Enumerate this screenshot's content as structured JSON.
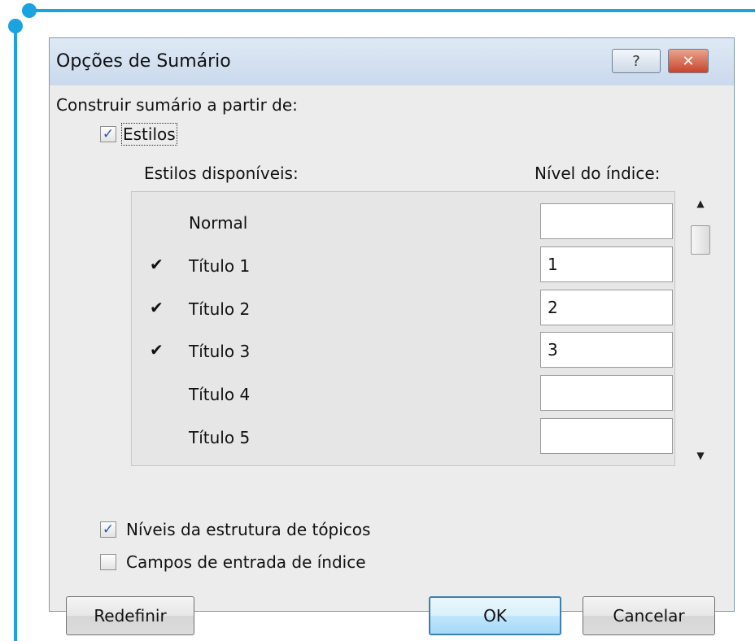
{
  "dialog": {
    "title": "Opções de Sumário",
    "help_glyph": "?",
    "close_glyph": "✕"
  },
  "build_from_label": "Construir sumário a partir de:",
  "styles_checkbox": {
    "label": "Estilos",
    "checked": true
  },
  "available_styles_header": "Estilos disponíveis:",
  "index_level_header": "Nível do índice:",
  "styles": [
    {
      "checked": true,
      "mark": "",
      "name": "Normal",
      "level": ""
    },
    {
      "checked": true,
      "mark": "✔",
      "name": "Título 1",
      "level": "1"
    },
    {
      "checked": true,
      "mark": "✔",
      "name": "Título 2",
      "level": "2"
    },
    {
      "checked": true,
      "mark": "✔",
      "name": "Título 3",
      "level": "3"
    },
    {
      "checked": false,
      "mark": "",
      "name": "Título 4",
      "level": ""
    },
    {
      "checked": false,
      "mark": "",
      "name": "Título 5",
      "level": ""
    }
  ],
  "scroll": {
    "up_glyph": "▲",
    "down_glyph": "▼"
  },
  "outline_levels_checkbox": {
    "label": "Níveis da estrutura de tópicos",
    "checked": true
  },
  "index_fields_checkbox": {
    "label": "Campos de entrada de índice",
    "checked": false
  },
  "checkbox_glyph": "✓",
  "buttons": {
    "reset": "Redefinir",
    "ok": "OK",
    "cancel": "Cancelar"
  },
  "colors": {
    "accent_frame": "#1aa3e0",
    "close_button": "#c9442b",
    "default_button_border": "#3c7fb1"
  }
}
